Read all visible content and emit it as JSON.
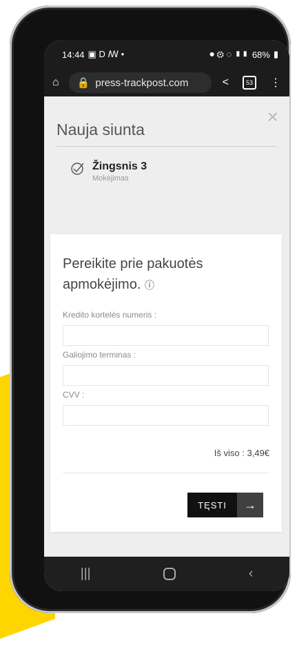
{
  "status_bar": {
    "time": "14:44",
    "left_icons": "▣ D ꟿ •",
    "right_icons": "⏺ ⚙ ◌ ▮▮",
    "battery": "68%"
  },
  "browser": {
    "url": "press-trackpost.com",
    "tab_count": "53"
  },
  "modal": {
    "title": "Nauja siunta",
    "close_label": "×"
  },
  "step": {
    "title": "Žingsnis 3",
    "subtitle": "Mokėjimas"
  },
  "payment": {
    "lead": "Pereikite prie pakuotės apmokėjimo.",
    "info_glyph": "ⓘ",
    "fields": [
      {
        "label": "Kredito kortelės numeris :",
        "value": ""
      },
      {
        "label": "Galiojimo terminas :",
        "value": ""
      },
      {
        "label": "CVV :",
        "value": ""
      }
    ],
    "total": "Iš viso : 3,49€",
    "next_label": "TĘSTI",
    "next_arrow": "→"
  },
  "nav": {
    "recent": "|||",
    "back": "‹"
  }
}
